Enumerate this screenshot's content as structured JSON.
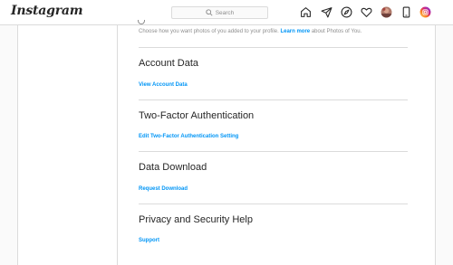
{
  "header": {
    "logo": "Instagram",
    "search_placeholder": "Search",
    "icons": [
      "home-icon",
      "direct-icon",
      "explore-icon",
      "heart-icon",
      "avatar",
      "phone-icon",
      "instagram-circle-icon"
    ]
  },
  "content": {
    "photos_of_you_desc": "Choose how you want photos of you added to your profile.",
    "learn_more": "Learn more",
    "photos_of_you_suffix": "about Photos of You.",
    "sections": [
      {
        "title": "Account Data",
        "link": "View Account Data"
      },
      {
        "title": "Two-Factor Authentication",
        "link": "Edit Two-Factor Authentication Setting"
      },
      {
        "title": "Data Download",
        "link": "Request Download"
      },
      {
        "title": "Privacy and Security Help",
        "link": "Support"
      }
    ]
  },
  "colors": {
    "link": "#0095f6",
    "border": "#dbdbdb",
    "muted": "#8e8e8e"
  }
}
